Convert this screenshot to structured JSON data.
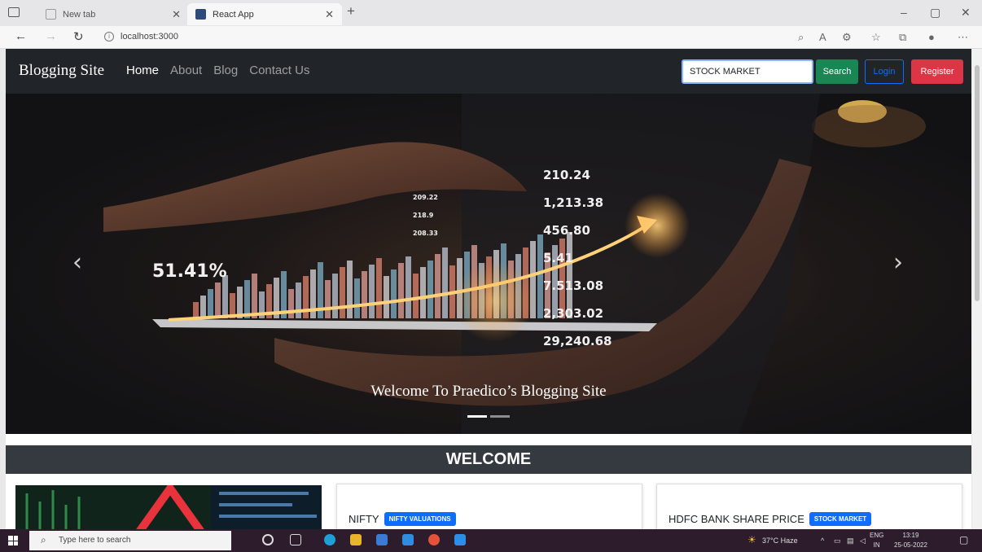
{
  "browser": {
    "tabs": [
      {
        "title": "New tab",
        "active": false
      },
      {
        "title": "React App",
        "active": true
      }
    ],
    "url": "localhost:3000"
  },
  "site": {
    "brand": "Blogging Site",
    "nav": [
      "Home",
      "About",
      "Blog",
      "Contact Us"
    ],
    "active_nav": "Home",
    "search_value": "STOCK MARKET",
    "search_button": "Search",
    "login_button": "Login",
    "register_button": "Register"
  },
  "hero": {
    "caption": "Welcome To Praedico’s Blogging Site",
    "overlay_numbers": [
      "210.24",
      "1,213.38",
      "456.80",
      "5.41",
      "7.513.08",
      "2,303.02",
      "29,240.68"
    ],
    "overlay_small": [
      "209.22",
      "218.9",
      "208.33"
    ],
    "percent": "51.41%",
    "slides": 2,
    "active_slide": 0
  },
  "welcome_title": "WELCOME",
  "cards": [
    {
      "title": "NIFTY",
      "badge": "NIFTY VALUATIONS"
    },
    {
      "title": "HDFC BANK SHARE PRICE",
      "badge": "STOCK MARKET"
    }
  ],
  "taskbar": {
    "search_placeholder": "Type here to search",
    "weather": "37°C Haze",
    "lang_top": "ENG",
    "lang_bottom": "IN",
    "time": "13:19",
    "date": "25-05-2022"
  },
  "colors": {
    "navbar": "#212529",
    "search_btn": "#198754",
    "login_btn": "#0d6efd",
    "register_btn": "#dc3545",
    "badge": "#0d6efd"
  }
}
